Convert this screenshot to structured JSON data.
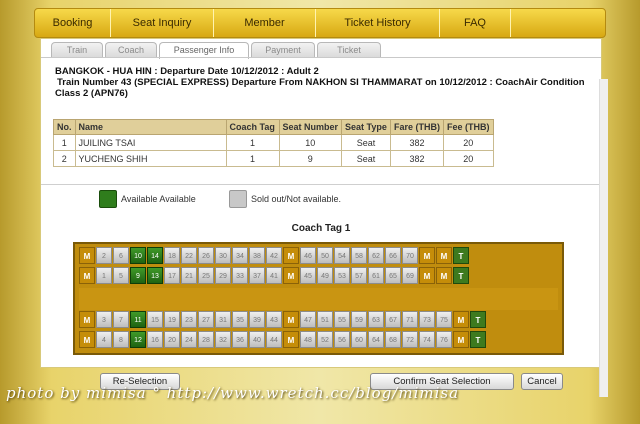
{
  "nav": [
    "Booking",
    "Seat Inquiry",
    "Member",
    "Ticket History",
    "FAQ"
  ],
  "tabs": [
    "Train",
    "Coach",
    "Passenger Info",
    "Payment",
    "Ticket"
  ],
  "info": {
    "line1": "BANGKOK - HUA HIN : Departure Date 10/12/2012 : Adult 2",
    "line2": "Train Number 43 (SPECIAL EXPRESS) Departure From NAKHON SI THAMMARAT on 10/12/2012 : CoachAir Condition",
    "line3": "Class 2 (APN76)"
  },
  "passengers": {
    "headers": [
      "No.",
      "Name",
      "Coach Tag",
      "Seat Number",
      "Seat Type",
      "Fare (THB)",
      "Fee (THB)"
    ],
    "rows": [
      [
        "1",
        "JUILING TSAI",
        "1",
        "10",
        "Seat",
        "382",
        "20"
      ],
      [
        "2",
        "YUCHENG SHIH",
        "1",
        "9",
        "Seat",
        "382",
        "20"
      ]
    ]
  },
  "legend": {
    "available": "Available Available",
    "sold": "Sold out/Not available."
  },
  "coach_tag": "Coach Tag 1",
  "seatmap": {
    "markers": {
      "m": "M",
      "t": "T"
    },
    "rows": [
      {
        "left": [
          "M"
        ],
        "seats": [
          [
            "2",
            false
          ],
          [
            "6",
            false
          ],
          [
            "10",
            true
          ],
          [
            "14",
            true
          ],
          [
            "18",
            false
          ],
          [
            "22",
            false
          ],
          [
            "26",
            false
          ],
          [
            "30",
            false
          ],
          [
            "34",
            false
          ],
          [
            "38",
            false
          ],
          [
            "42",
            false
          ]
        ],
        "mid": "M",
        "seats2": [
          [
            "46",
            false
          ],
          [
            "50",
            false
          ],
          [
            "54",
            false
          ],
          [
            "58",
            false
          ],
          [
            "62",
            false
          ],
          [
            "66",
            false
          ],
          [
            "70",
            false
          ]
        ],
        "right": [
          "M",
          "M",
          "T"
        ]
      },
      {
        "left": [
          "M"
        ],
        "seats": [
          [
            "1",
            false
          ],
          [
            "5",
            false
          ],
          [
            "9",
            true
          ],
          [
            "13",
            true
          ],
          [
            "17",
            false
          ],
          [
            "21",
            false
          ],
          [
            "25",
            false
          ],
          [
            "29",
            false
          ],
          [
            "33",
            false
          ],
          [
            "37",
            false
          ],
          [
            "41",
            false
          ]
        ],
        "mid": "M",
        "seats2": [
          [
            "45",
            false
          ],
          [
            "49",
            false
          ],
          [
            "53",
            false
          ],
          [
            "57",
            false
          ],
          [
            "61",
            false
          ],
          [
            "65",
            false
          ],
          [
            "69",
            false
          ]
        ],
        "right": [
          "M",
          "M",
          "T"
        ]
      },
      {
        "left": [
          "M"
        ],
        "seats": [
          [
            "3",
            false
          ],
          [
            "7",
            false
          ],
          [
            "11",
            true
          ],
          [
            "15",
            false
          ],
          [
            "19",
            false
          ],
          [
            "23",
            false
          ],
          [
            "27",
            false
          ],
          [
            "31",
            false
          ],
          [
            "35",
            false
          ],
          [
            "39",
            false
          ],
          [
            "43",
            false
          ]
        ],
        "mid": "M",
        "seats2": [
          [
            "47",
            false
          ],
          [
            "51",
            false
          ],
          [
            "55",
            false
          ],
          [
            "59",
            false
          ],
          [
            "63",
            false
          ],
          [
            "67",
            false
          ],
          [
            "71",
            false
          ],
          [
            "73",
            false
          ],
          [
            "75",
            false
          ]
        ],
        "right": [
          "M",
          "T"
        ]
      },
      {
        "left": [
          "M"
        ],
        "seats": [
          [
            "4",
            false
          ],
          [
            "8",
            false
          ],
          [
            "12",
            true
          ],
          [
            "16",
            false
          ],
          [
            "20",
            false
          ],
          [
            "24",
            false
          ],
          [
            "28",
            false
          ],
          [
            "32",
            false
          ],
          [
            "36",
            false
          ],
          [
            "40",
            false
          ],
          [
            "44",
            false
          ]
        ],
        "mid": "M",
        "seats2": [
          [
            "48",
            false
          ],
          [
            "52",
            false
          ],
          [
            "56",
            false
          ],
          [
            "60",
            false
          ],
          [
            "64",
            false
          ],
          [
            "68",
            false
          ],
          [
            "72",
            false
          ],
          [
            "74",
            false
          ],
          [
            "76",
            false
          ]
        ],
        "right": [
          "M",
          "T"
        ]
      }
    ]
  },
  "buttons": {
    "reselect": "Re-Selection",
    "confirm": "Confirm Seat Selection",
    "cancel": "Cancel"
  },
  "watermark": "photo by mimisa ° http://www.wretch.cc/blog/mimisa",
  "colors": {
    "available": "#2f7d1c",
    "sold": "#c8c8c8",
    "brand": "#d7a812"
  }
}
